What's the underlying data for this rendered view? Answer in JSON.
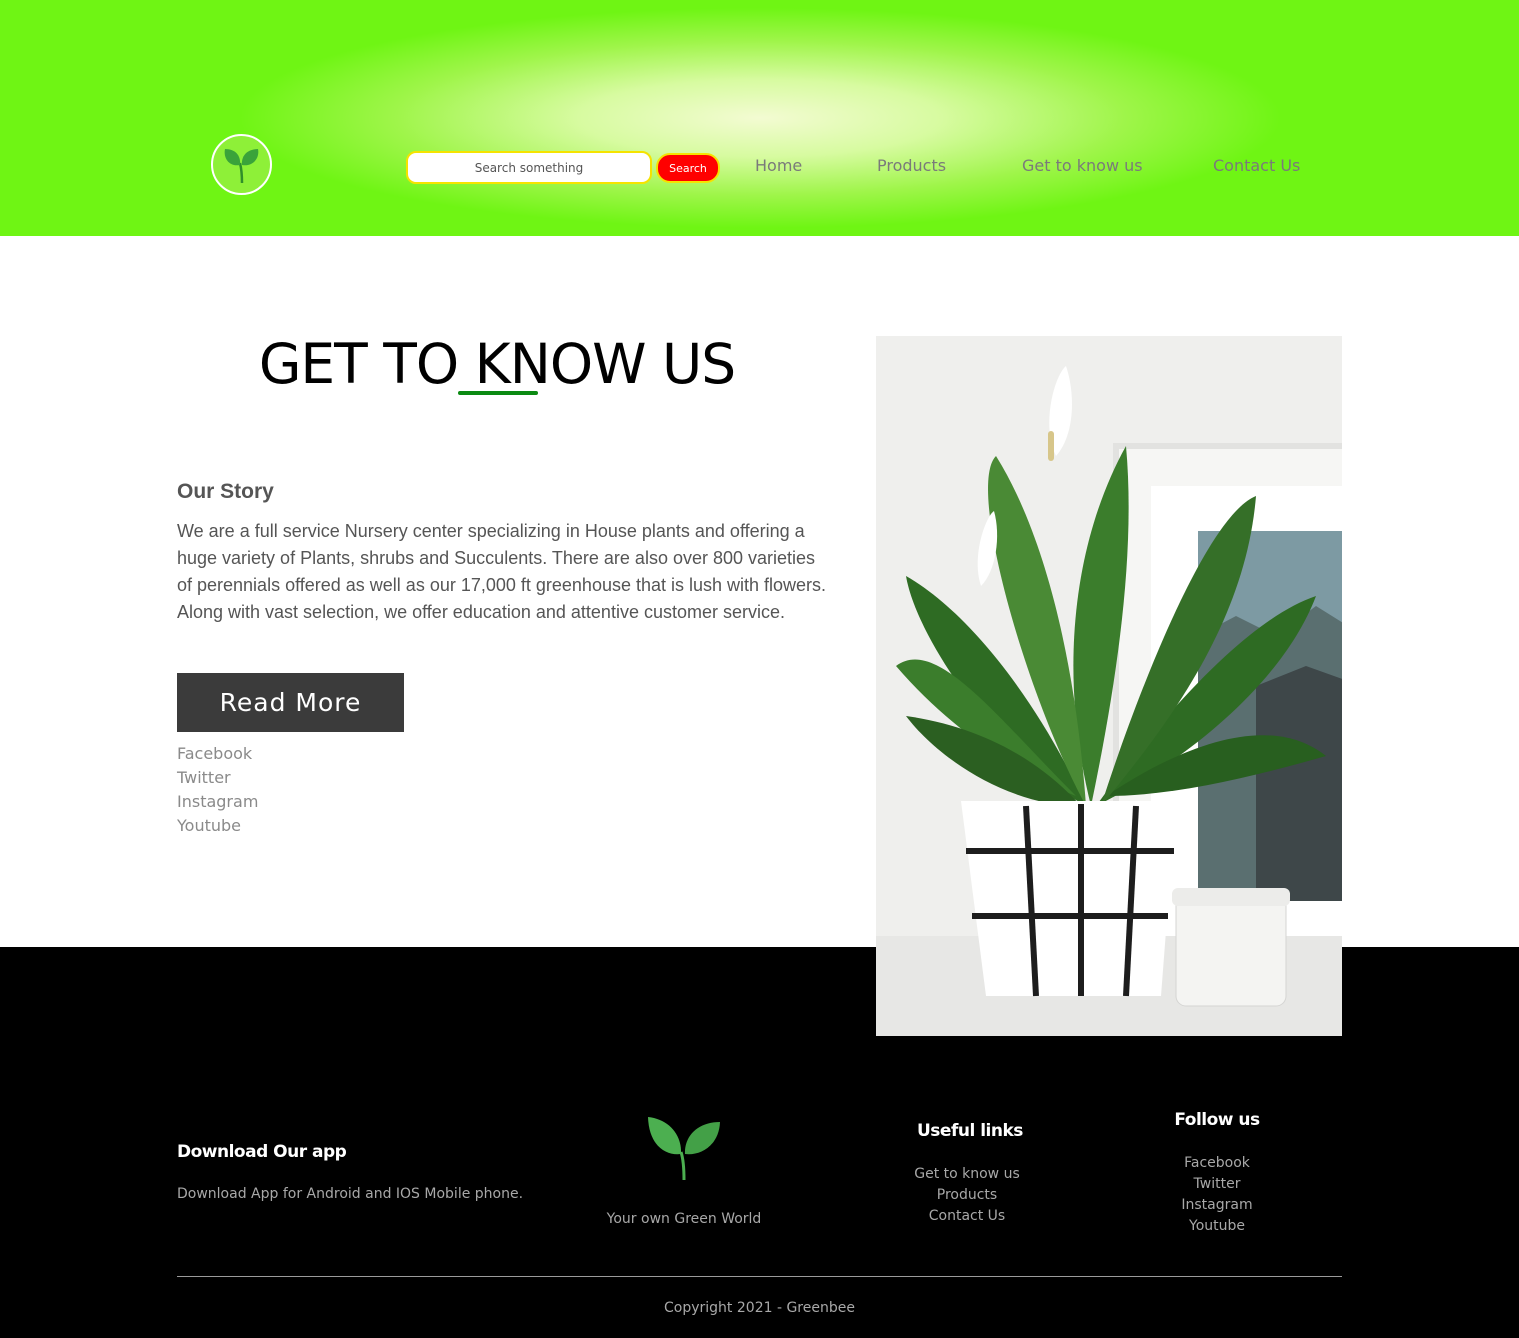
{
  "header": {
    "search": {
      "placeholder": "Search something",
      "button_label": "Search"
    },
    "nav": [
      {
        "label": "Home"
      },
      {
        "label": "Products"
      },
      {
        "label": "Get to know us"
      },
      {
        "label": "Contact Us"
      }
    ]
  },
  "main": {
    "title": "GET TO KNOW US",
    "story_heading": "Our Story",
    "story_text": "We are a full service Nursery center specializing in House plants and offering a huge variety of Plants, shrubs and Succulents. There are also over 800 varieties of perennials offered as well as our 17,000 ft greenhouse that is lush with flowers. Along with vast selection, we offer education and attentive customer service.",
    "read_more_label": "Read More",
    "social": [
      "Facebook",
      "Twitter",
      "Instagram",
      "Youtube"
    ]
  },
  "footer": {
    "download": {
      "heading": "Download Our app",
      "text": "Download App for Android and IOS Mobile phone."
    },
    "brand": {
      "tagline": "Your own Green World"
    },
    "useful_links": {
      "heading": "Useful links",
      "items": [
        "Get to know us",
        "Products",
        "Contact Us"
      ]
    },
    "follow": {
      "heading": "Follow us",
      "items": [
        "Facebook",
        "Twitter",
        "Instagram",
        "Youtube"
      ]
    },
    "copyright": "Copyright 2021 - Greenbee"
  },
  "colors": {
    "header_green": "#6ff514",
    "search_button": "#ff0000",
    "search_border": "#f5e300",
    "title_underline": "#0b8a12",
    "read_more_bg": "#3b3b3b",
    "footer_bg": "#000000"
  },
  "icons": {
    "logo": "sprout-icon",
    "footer_logo": "sprout-icon"
  }
}
